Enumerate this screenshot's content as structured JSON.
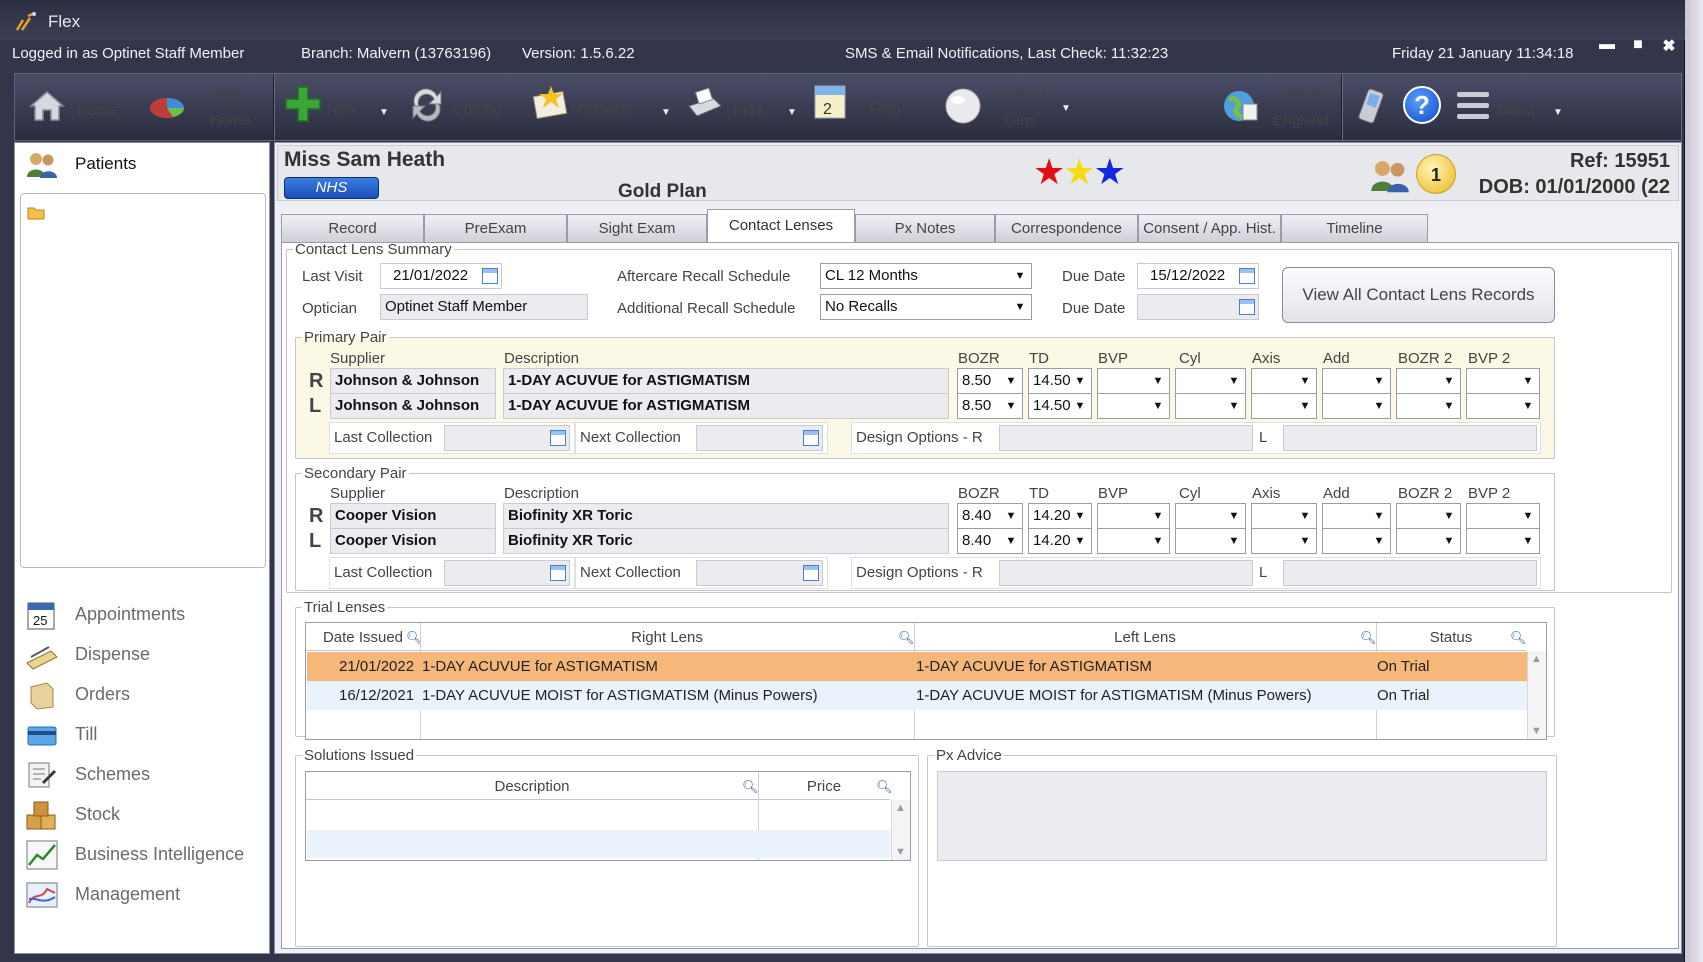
{
  "window": {
    "title": "Flex",
    "logged_in": "Logged in as Optinet Staff Member",
    "branch": "Branch: Malvern (13763196)",
    "version": "Version: 1.5.6.22",
    "notifications": "SMS & Email Notifications, Last Check: 11:32:23",
    "datetime": "Friday 21 January 11:34:18",
    "minimize": "▬",
    "maximize": "■",
    "close": "✖"
  },
  "toolbar": {
    "home": "Home",
    "mgr_home_1": "Mgr.",
    "mgr_home_2": "Home",
    "new": "New",
    "update": "Update",
    "message": "Message",
    "print": "Print",
    "files": "Files",
    "contact_lens_1": "Contact",
    "contact_lens_2": "Lens",
    "egos_1": "eGOS",
    "egos_2": "England",
    "menu": "Menu",
    "help": "?"
  },
  "sidebar": {
    "patients": "Patients",
    "items": [
      "Appointments",
      "Dispense",
      "Orders",
      "Till",
      "Schemes",
      "Stock",
      "Business Intelligence",
      "Management"
    ]
  },
  "patient": {
    "name": "Miss Sam Heath",
    "nhs": "NHS",
    "plan": "Gold Plan",
    "ref": "Ref: 15951",
    "dob": "DOB: 01/01/2000 (22",
    "badge": "1",
    "star_colors": [
      "#e01010",
      "#f4dc10",
      "#1028e0"
    ]
  },
  "tabs": [
    "Record",
    "PreExam",
    "Sight Exam",
    "Contact Lenses",
    "Px Notes",
    "Correspondence",
    "Consent / App. Hist.",
    "Timeline"
  ],
  "summary": {
    "legend": "Contact Lens Summary",
    "last_visit_label": "Last Visit",
    "last_visit": "21/01/2022",
    "optician_label": "Optician",
    "optician": "Optinet Staff Member",
    "aftercare_label": "Aftercare Recall Schedule",
    "aftercare": "CL 12 Months",
    "additional_label": "Additional Recall Schedule",
    "additional": "No Recalls",
    "due_label": "Due Date",
    "due_date": "15/12/2022",
    "due_label2": "Due Date",
    "due_date2": "",
    "view_all": "View All Contact Lens Records"
  },
  "cols": {
    "supplier": "Supplier",
    "description": "Description",
    "bozr": "BOZR",
    "td": "TD",
    "bvp": "BVP",
    "cyl": "Cyl",
    "axis": "Axis",
    "add": "Add",
    "bozr2": "BOZR 2",
    "bvp2": "BVP 2"
  },
  "primary": {
    "legend": "Primary Pair",
    "r": "R",
    "l": "L",
    "r_supplier": "Johnson & Johnson",
    "r_desc": "1-DAY ACUVUE for ASTIGMATISM",
    "r_bozr": "8.50",
    "r_td": "14.50",
    "l_supplier": "Johnson & Johnson",
    "l_desc": "1-DAY ACUVUE for ASTIGMATISM",
    "l_bozr": "8.50",
    "l_td": "14.50",
    "last_collection": "Last Collection",
    "next_collection": "Next Collection",
    "design_r": "Design Options - R",
    "design_l": "L"
  },
  "secondary": {
    "legend": "Secondary Pair",
    "r": "R",
    "l": "L",
    "r_supplier": "Cooper Vision",
    "r_desc": "Biofinity XR Toric",
    "r_bozr": "8.40",
    "r_td": "14.20",
    "l_supplier": "Cooper Vision",
    "l_desc": "Biofinity XR Toric",
    "l_bozr": "8.40",
    "l_td": "14.20",
    "last_collection": "Last Collection",
    "next_collection": "Next Collection",
    "design_r": "Design Options - R",
    "design_l": "L"
  },
  "trial": {
    "legend": "Trial Lenses",
    "headers": [
      "Date Issued",
      "Right Lens",
      "Left Lens",
      "Status"
    ],
    "rows": [
      {
        "date": "21/01/2022",
        "right": "1-DAY ACUVUE for ASTIGMATISM",
        "left": "1-DAY ACUVUE for ASTIGMATISM",
        "status": "On Trial"
      },
      {
        "date": "16/12/2021",
        "right": "1-DAY ACUVUE MOIST for ASTIGMATISM (Minus Powers)",
        "left": "1-DAY ACUVUE MOIST for ASTIGMATISM (Minus Powers)",
        "status": "On Trial"
      }
    ],
    "selected_color": "#f6b77a"
  },
  "solutions": {
    "legend": "Solutions Issued",
    "headers": [
      "Description",
      "Price"
    ]
  },
  "advice": {
    "legend": "Px Advice"
  }
}
